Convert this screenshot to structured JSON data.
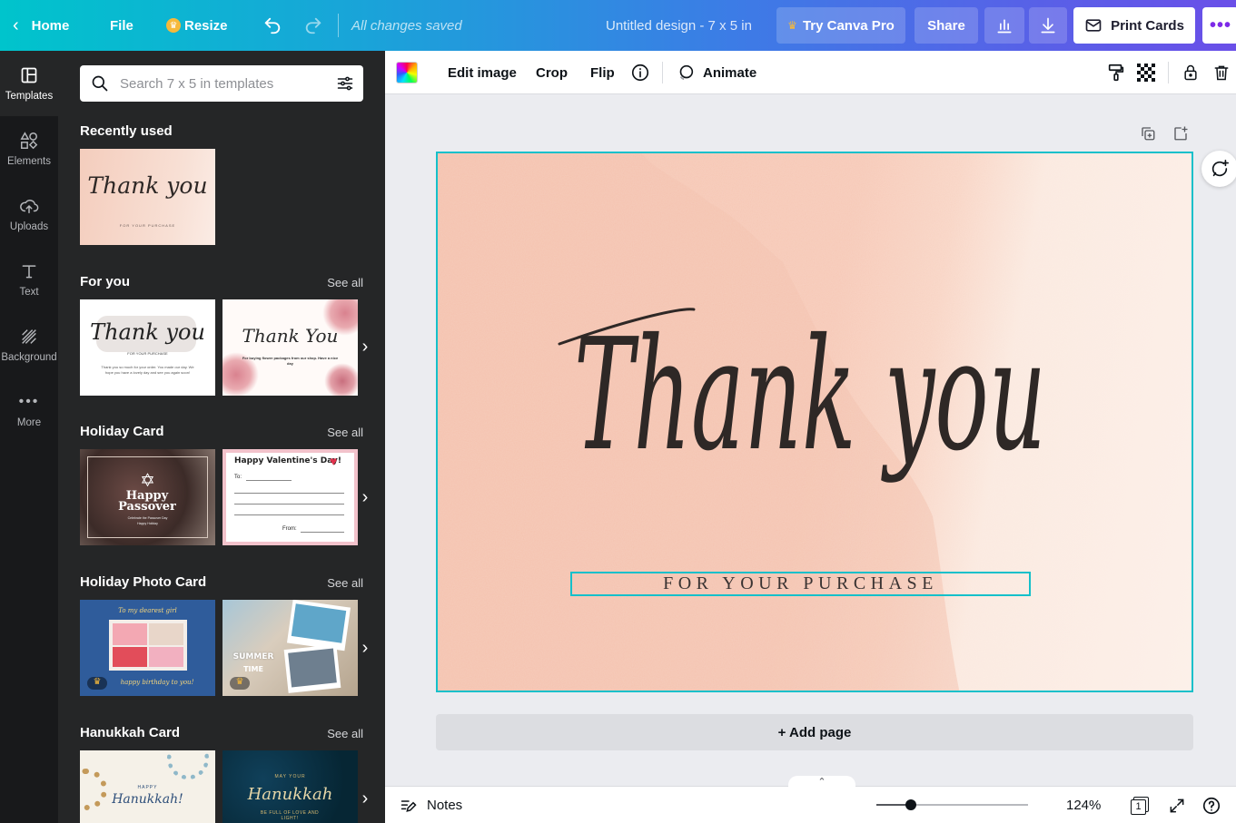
{
  "topbar": {
    "home": "Home",
    "file": "File",
    "resize": "Resize",
    "saved_status": "All changes saved",
    "doc_title": "Untitled design - 7 x 5 in",
    "try_pro": "Try Canva Pro",
    "share": "Share",
    "print": "Print Cards"
  },
  "rail": [
    {
      "label": "Templates",
      "icon": "templates-icon"
    },
    {
      "label": "Elements",
      "icon": "elements-icon"
    },
    {
      "label": "Uploads",
      "icon": "upload-icon"
    },
    {
      "label": "Text",
      "icon": "text-icon"
    },
    {
      "label": "Background",
      "icon": "background-icon"
    },
    {
      "label": "More",
      "icon": "more-icon"
    }
  ],
  "panel": {
    "search_placeholder": "Search 7 x 5 in templates",
    "see_all": "See all",
    "recent": {
      "title": "Recently used",
      "thumb_title": "Thank you",
      "thumb_sub": "FOR YOUR PURCHASE"
    },
    "for_you": {
      "title": "For you",
      "t1_title": "Thank you",
      "t1_sub": "FOR YOUR PURCHASE",
      "t1_body": "Thank you so much for your order. You made our day. We hope you have a lovely day and see you again soon!",
      "t2_title": "Thank You",
      "t2_body": "For buying flower packages from our shop. Have a nice day"
    },
    "holiday_card": {
      "title": "Holiday Card",
      "t1_title": "Happy Passover",
      "t1_sub": "Celebrate the Passover Day",
      "t1_small": "Happy Holiday",
      "t2_title": "Happy Valentine's Day!",
      "t2_to": "To:",
      "t2_from": "From:"
    },
    "holiday_photo": {
      "title": "Holiday Photo Card",
      "t1_top": "To my dearest girl",
      "t1_bottom": "happy birthday to you!",
      "t2_a": "SUMMER",
      "t2_b": "TIME"
    },
    "hanukkah": {
      "title": "Hanukkah Card",
      "t1_a": "HAPPY",
      "t1_b": "Hanukkah!",
      "t2_a": "MAY YOUR",
      "t2_b": "Hanukkah",
      "t2_c": "BE FULL OF LOVE AND LIGHT!"
    }
  },
  "context_toolbar": {
    "edit_image": "Edit image",
    "crop": "Crop",
    "flip": "Flip",
    "animate": "Animate"
  },
  "design": {
    "title": "Thank you",
    "subtitle": "FOR YOUR PURCHASE",
    "colors": {
      "peach": "#f5c4b0",
      "ink": "#2e2826",
      "selection": "#14c0ca"
    }
  },
  "canvas": {
    "add_page": "+ Add page"
  },
  "bottombar": {
    "notes": "Notes",
    "zoom": "124%",
    "zoom_fraction": 0.23,
    "page_number": "1"
  }
}
